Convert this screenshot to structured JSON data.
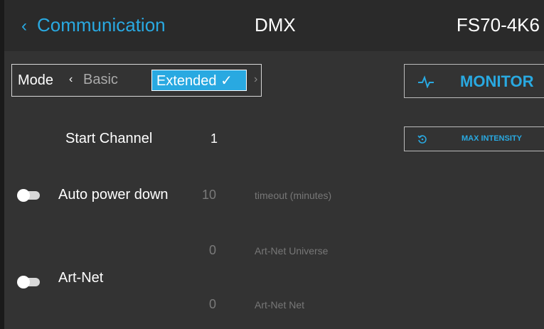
{
  "header": {
    "back_label": "Communication",
    "title": "DMX",
    "model": "FS70-4K6"
  },
  "mode": {
    "label": "Mode",
    "prev_arrow": "‹",
    "prev_option": "Basic",
    "selected": "Extended ✓",
    "next_arrow": "›"
  },
  "start_channel": {
    "label": "Start Channel",
    "value": "1"
  },
  "auto_power_down": {
    "label": "Auto power down",
    "value": "10",
    "hint": "timeout (minutes)",
    "enabled": false
  },
  "art_net": {
    "label": "Art-Net",
    "enabled": false,
    "universe_value": "0",
    "universe_hint": "Art-Net Universe",
    "net_value": "0",
    "net_hint": "Art-Net Net"
  },
  "buttons": {
    "monitor": "MONITOR",
    "max_intensity": "MAX INTENSITY"
  },
  "icons": {
    "back": "chevron-left-icon",
    "monitor": "pulse-icon",
    "max_intensity": "reset-icon"
  },
  "colors": {
    "accent": "#29a9e1",
    "background": "#333333",
    "header": "#2a2a2a"
  }
}
